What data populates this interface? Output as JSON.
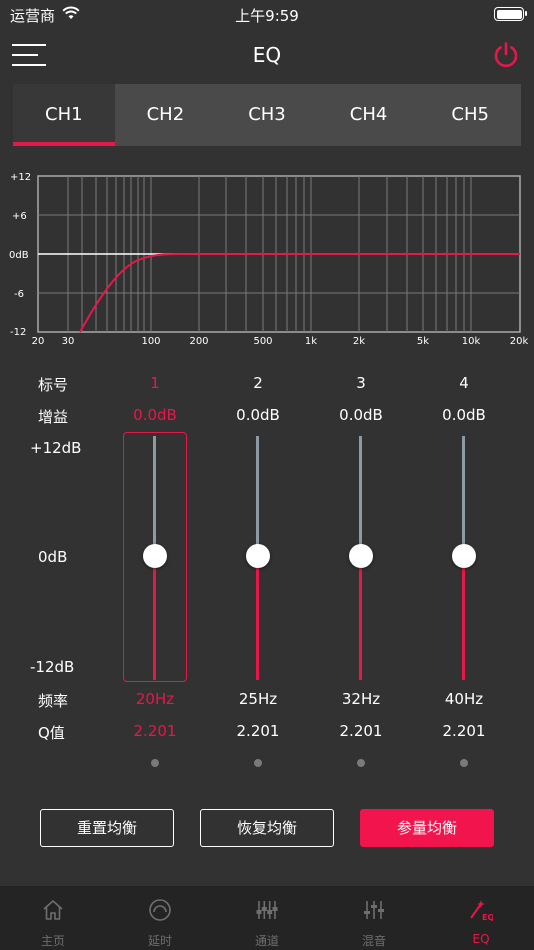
{
  "status_bar": {
    "carrier": "运营商",
    "time": "上午9:59"
  },
  "nav": {
    "title": "EQ"
  },
  "channel_tabs": [
    {
      "label": "CH1",
      "active": true
    },
    {
      "label": "CH2",
      "active": false
    },
    {
      "label": "CH3",
      "active": false
    },
    {
      "label": "CH4",
      "active": false
    },
    {
      "label": "CH5",
      "active": false
    }
  ],
  "graph": {
    "y_ticks": [
      "+12",
      "+6",
      "0dB",
      "-6",
      "-12"
    ],
    "x_ticks": [
      "20",
      "30",
      "100",
      "200",
      "500",
      "1k",
      "2k",
      "5k",
      "10k",
      "20k"
    ],
    "curve_color": "#e8174a"
  },
  "params": {
    "label_index": "标号",
    "label_gain": "增益",
    "label_freq": "频率",
    "label_q": "Q值",
    "scale_top": "+12dB",
    "scale_mid": "0dB",
    "scale_bottom": "-12dB"
  },
  "bands": [
    {
      "index": "1",
      "gain": "0.0dB",
      "freq": "20Hz",
      "q": "2.201",
      "level": 0.5,
      "selected": true
    },
    {
      "index": "2",
      "gain": "0.0dB",
      "freq": "25Hz",
      "q": "2.201",
      "level": 0.5,
      "selected": false
    },
    {
      "index": "3",
      "gain": "0.0dB",
      "freq": "32Hz",
      "q": "2.201",
      "level": 0.5,
      "selected": false
    },
    {
      "index": "4",
      "gain": "0.0dB",
      "freq": "40Hz",
      "q": "2.201",
      "level": 0.5,
      "selected": false
    }
  ],
  "buttons": {
    "reset": "重置均衡",
    "restore": "恢复均衡",
    "param": "参量均衡"
  },
  "tabbar": [
    {
      "label": "主页",
      "icon": "home-icon",
      "active": false
    },
    {
      "label": "延时",
      "icon": "delay-icon",
      "active": false
    },
    {
      "label": "通道",
      "icon": "channel-icon",
      "active": false
    },
    {
      "label": "混音",
      "icon": "mixer-icon",
      "active": false
    },
    {
      "label": "EQ",
      "icon": "eq-icon",
      "active": true
    }
  ],
  "colors": {
    "accent": "#e8174a",
    "background": "#323232",
    "tab_bg": "#4a4a4a"
  }
}
